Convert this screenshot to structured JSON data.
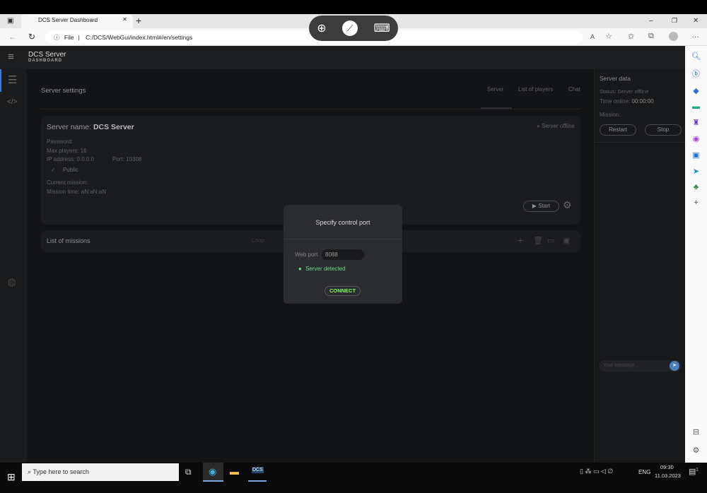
{
  "browser": {
    "tab_title": "DCS Server Dashboard",
    "new_tab": "+",
    "file_label": "File",
    "url": "C:/DCS/WebGui/index.html#/en/settings",
    "window_controls": [
      "–",
      "❐",
      "✕"
    ]
  },
  "app": {
    "title": "DCS Server",
    "subtitle": "DASHBOARD"
  },
  "main": {
    "heading": "Server settings",
    "tabs": [
      "Server",
      "List of players",
      "Chat"
    ],
    "server_card": {
      "name_label": "Server name:",
      "name": "DCS Server",
      "status": "Server offline",
      "password": "Password:",
      "max_players": "Max players: 16",
      "ip": "IP address: 0.0.0.0",
      "port": "Port: 10308",
      "public": "Public",
      "current_mission": "Current mission:",
      "mission_time": "Mission time: aN:aN:aN",
      "start": "Start"
    },
    "missions": {
      "title": "List of missions",
      "loop": "Loop"
    }
  },
  "right_panel": {
    "title": "Server data",
    "status": "Status: Server offline",
    "time_online_label": "Time online:",
    "time_online": "00:00:00",
    "mission": "Mission:",
    "restart": "Restart",
    "stop": "Stop",
    "message_placeholder": "Your message..."
  },
  "modal": {
    "title": "Specify control port",
    "web_port_label": "Web port",
    "web_port_value": "8088",
    "detected": "Server detected",
    "connect": "CONNECT"
  },
  "taskbar": {
    "search_placeholder": "Type here to search",
    "lang": "ENG",
    "time": "09:30",
    "date": "11.03.2023",
    "notifications": "1"
  },
  "colors": {
    "accent_green": "#7cff4a",
    "detected_green": "#6fdc8c",
    "nav_accent": "#3a7bd5"
  }
}
